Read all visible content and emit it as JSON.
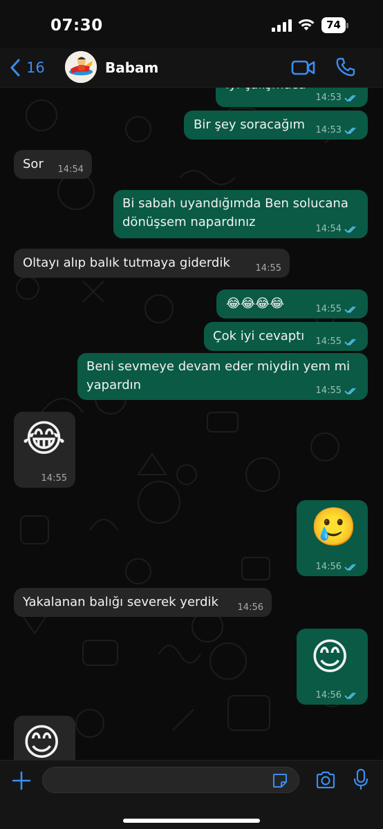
{
  "status_bar": {
    "time": "07:30",
    "battery": "74"
  },
  "header": {
    "back_count": "16",
    "contact_name": "Babam",
    "accent_color": "#3a8ef0"
  },
  "messages": [
    {
      "dir": "out",
      "text": "İyi çalışmaca",
      "time": "14:53",
      "read": true
    },
    {
      "dir": "out",
      "text": "Bir şey soracağım",
      "time": "14:53",
      "read": true
    },
    {
      "dir": "in",
      "text": "Sor",
      "time": "14:54"
    },
    {
      "dir": "out",
      "text": "Bi sabah uyandığımda Ben solucana dönüşsem napardınız",
      "time": "14:54",
      "read": true
    },
    {
      "dir": "in",
      "text": "Oltayı alıp balık tutmaya giderdik",
      "time": "14:55"
    },
    {
      "dir": "out",
      "text": "😂😂😂😂",
      "time": "14:55",
      "read": true
    },
    {
      "dir": "out",
      "text": "Çok iyi cevaptı",
      "time": "14:55",
      "read": true
    },
    {
      "dir": "out",
      "text": "Beni sevmeye devam eder miydin yem mi yapardın",
      "time": "14:55",
      "read": true
    },
    {
      "dir": "in",
      "emoji": "😂",
      "time": "14:55"
    },
    {
      "dir": "out",
      "emoji": "🥲",
      "time": "14:56",
      "read": true
    },
    {
      "dir": "in",
      "text": "Yakalanan balığı severek yerdik",
      "time": "14:56"
    },
    {
      "dir": "out",
      "emoji": "😊",
      "time": "14:56",
      "read": true
    },
    {
      "dir": "in",
      "emoji": "😊",
      "time": ""
    }
  ],
  "composer": {
    "placeholder": ""
  },
  "colors": {
    "incoming_bubble": "#262626",
    "outgoing_bubble": "#0a5a45",
    "read_tick": "#53bdeb"
  }
}
